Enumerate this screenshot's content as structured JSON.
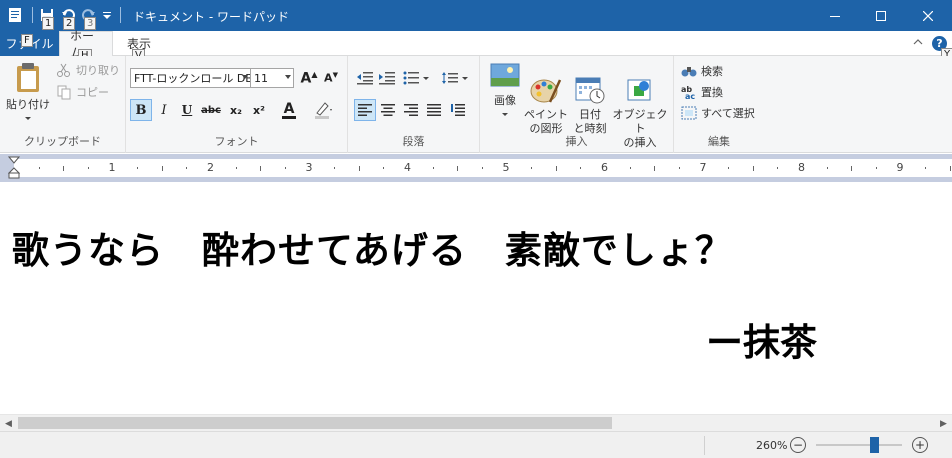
{
  "window": {
    "title": "ドキュメント - ワードパッド",
    "quick_access_keytips": [
      "1",
      "2",
      "3"
    ],
    "help_keytip": "Y"
  },
  "tabs": {
    "file": {
      "label": "ファイル",
      "keytip": "F"
    },
    "home": {
      "label": "ホーム",
      "keytip": "H"
    },
    "view": {
      "label": "表示",
      "keytip": "V"
    }
  },
  "ribbon": {
    "clipboard": {
      "label": "クリップボード",
      "paste": "貼り付け",
      "cut": "切り取り",
      "copy": "コピー"
    },
    "font": {
      "label": "フォント",
      "family": "FTT-ロックンロール DB",
      "size": "11",
      "bold": "B",
      "italic": "I",
      "underline": "U",
      "strike": "abc",
      "subscript": "x₂",
      "superscript": "x²",
      "color_letter": "A",
      "font_color": "#1e1e1e",
      "highlight_color": "#c8c8c8"
    },
    "paragraph": {
      "label": "段落"
    },
    "insert": {
      "label": "挿入",
      "picture": "画像",
      "paint": "ペイント\nの図形",
      "datetime": "日付\nと時刻",
      "object": "オブジェクト\nの挿入"
    },
    "editing": {
      "label": "編集",
      "find": "検索",
      "replace": "置換",
      "select_all": "すべて選択"
    }
  },
  "ruler": {
    "numbers": [
      "1",
      "2",
      "3",
      "4",
      "5",
      "6",
      "7",
      "8",
      "9"
    ]
  },
  "document": {
    "line1": "歌うなら　酔わせてあげる　素敵でしょ？",
    "line2": "ー抹茶"
  },
  "statusbar": {
    "zoom": "260%",
    "zoom_level": 0.68
  },
  "colors": {
    "accent": "#1e63a8"
  }
}
